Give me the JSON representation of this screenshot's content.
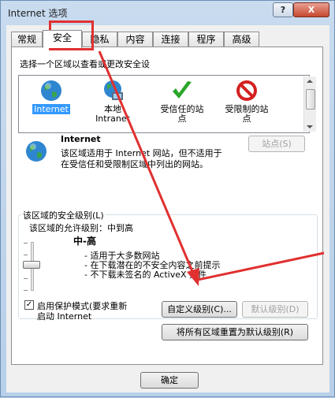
{
  "window": {
    "title": "Internet 选项",
    "help_label": "?",
    "close_label": "X"
  },
  "tabs": [
    {
      "label": "常规"
    },
    {
      "label": "安全"
    },
    {
      "label": "隐私"
    },
    {
      "label": "内容"
    },
    {
      "label": "连接"
    },
    {
      "label": "程序"
    },
    {
      "label": "高级"
    }
  ],
  "security": {
    "prompt": "选择一个区域以查看或更改安全设",
    "zones": [
      {
        "label": "Internet",
        "icon": "globe-icon",
        "selected": true
      },
      {
        "label": "本地\nIntranet",
        "icon": "intranet-globe-icon"
      },
      {
        "label": "受信任的站\n点",
        "icon": "checkmark-icon"
      },
      {
        "label": "受限制的站\n点",
        "icon": "no-entry-icon"
      }
    ],
    "zone_name": "Internet",
    "zone_desc_1": "该区域适用于 Internet 网站，但不适用于",
    "zone_desc_2": "在受信任和受限制区域中列出的网站。",
    "sites_button": "站点(S)",
    "level_group_label": "该区域的安全级别(L)",
    "allowed_levels": "该区域的允许级别：中到高",
    "level_name": "中-高",
    "bullets": [
      "- 适用于大多数网站",
      "- 在下载潜在的不安全内容之前提示",
      "- 不下载未签名的 ActiveX 控件"
    ],
    "protected_mode_line1": "启用保护模式(要求重新",
    "protected_mode_line2": "启动 Internet",
    "protected_mode_checked": true,
    "custom_level_button": "自定义级别(C)...",
    "default_level_button": "默认级别(D)",
    "reset_all_button": "将所有区域重置为默认级别(R)"
  },
  "footer": {
    "ok_button": "确定"
  },
  "colors": {
    "highlight": "#3399ff",
    "annotation": "#e03030"
  }
}
